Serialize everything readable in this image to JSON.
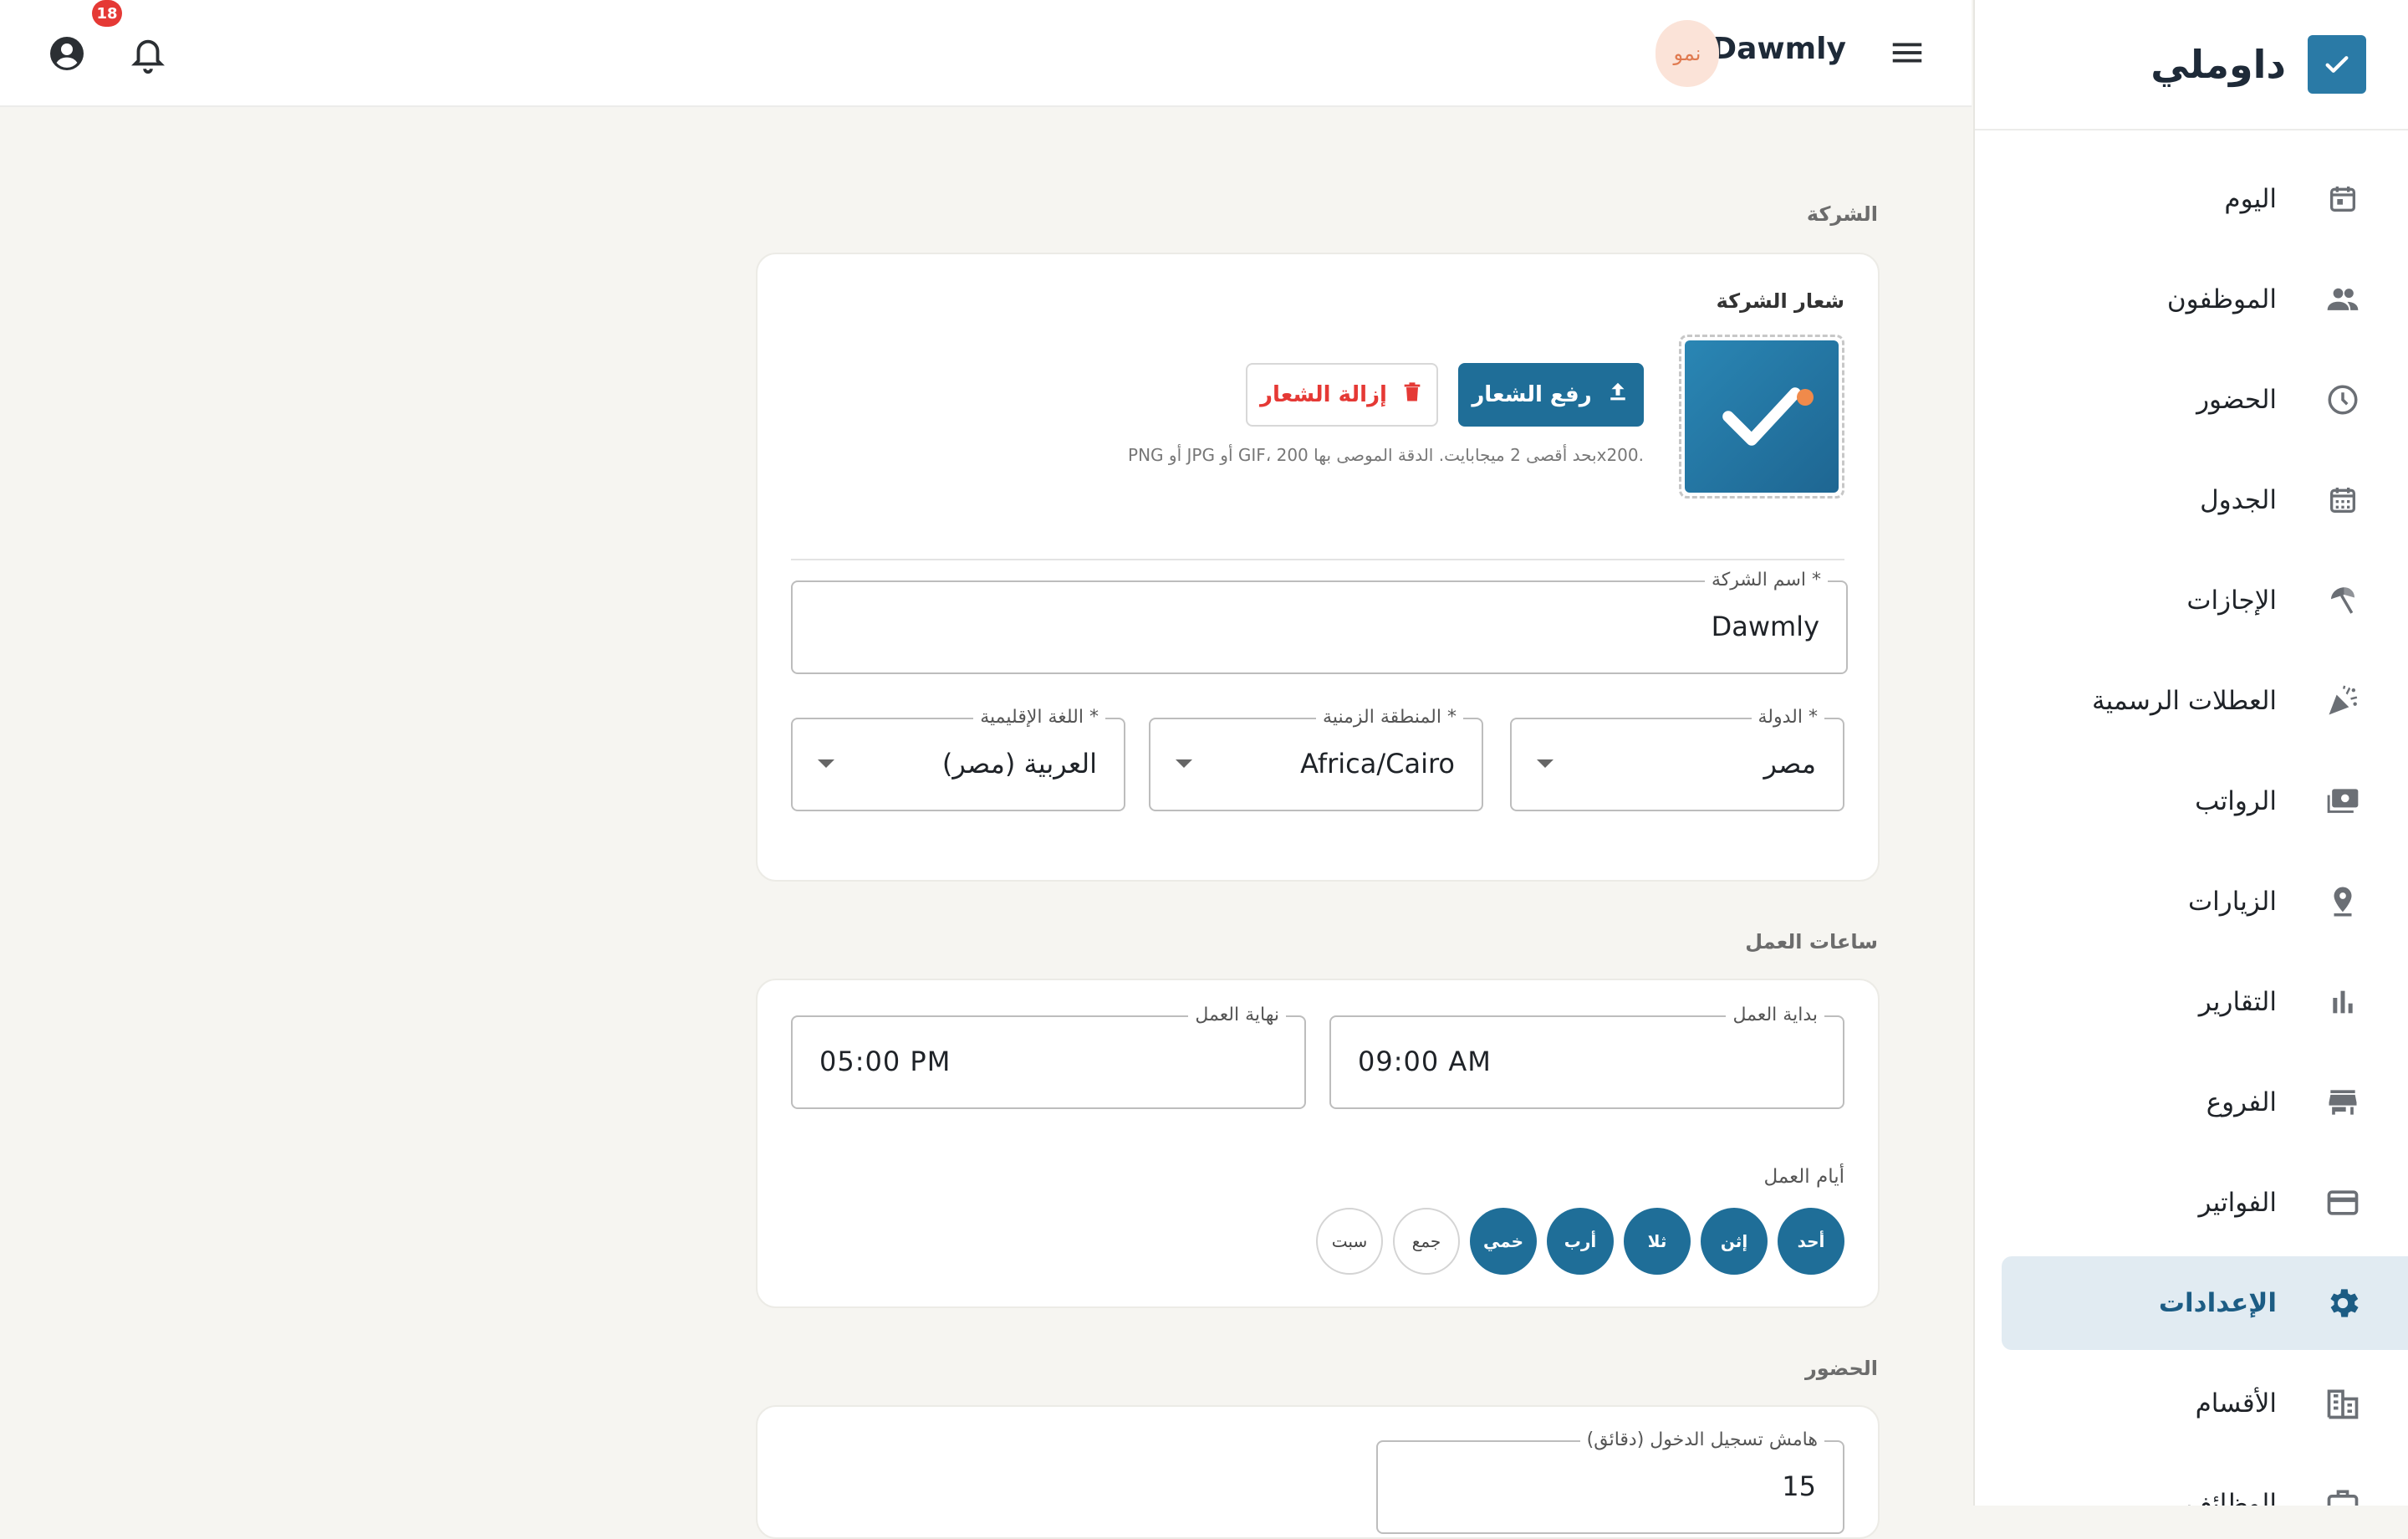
{
  "app": {
    "name": "داوملي",
    "company": "Dawmly",
    "avatar_text": "نمو",
    "notifications_count": "18"
  },
  "colors": {
    "accent": "#1f6e98",
    "brand": "#2a7aa6",
    "danger": "#e53935",
    "active_bg": "#e1ebf2"
  },
  "sidebar": {
    "items": [
      {
        "label": "اليوم",
        "icon": "calendar-today-icon"
      },
      {
        "label": "الموظفون",
        "icon": "people-icon"
      },
      {
        "label": "الحضور",
        "icon": "clock-icon"
      },
      {
        "label": "الجدول",
        "icon": "calendar-grid-icon"
      },
      {
        "label": "الإجازات",
        "icon": "beach-umbrella-icon"
      },
      {
        "label": "العطلات الرسمية",
        "icon": "celebration-icon"
      },
      {
        "label": "الرواتب",
        "icon": "payments-icon"
      },
      {
        "label": "الزيارات",
        "icon": "location-pin-icon"
      },
      {
        "label": "التقارير",
        "icon": "bar-chart-icon"
      },
      {
        "label": "الفروع",
        "icon": "store-icon"
      },
      {
        "label": "الفواتير",
        "icon": "credit-card-icon"
      },
      {
        "label": "الإعدادات",
        "icon": "gear-icon",
        "active": true
      },
      {
        "label": "الأقسام",
        "icon": "domain-icon"
      },
      {
        "label": "الوظائف",
        "icon": "briefcase-icon"
      }
    ]
  },
  "company_section": {
    "title": "الشركة",
    "logo_label": "شعار الشركة",
    "upload_label": "رفع الشعار",
    "remove_label": "إزالة الشعار",
    "logo_hint": "PNG أو JPG أو GIF، بحد أقصى 2 ميجابايت. الدقة الموصى بها 200x200.",
    "name_label": "اسم الشركة *",
    "name_value": "Dawmly",
    "country_label": "الدولة *",
    "country_value": "مصر",
    "timezone_label": "المنطقة الزمنية *",
    "timezone_value": "Africa/Cairo",
    "locale_label": "اللغة الإقليمية *",
    "locale_value": "العربية (مصر)"
  },
  "hours_section": {
    "title": "ساعات العمل",
    "start_label": "بداية العمل",
    "start_value": "09:00 AM",
    "end_label": "نهاية العمل",
    "end_value": "05:00 PM",
    "days_label": "أيام العمل",
    "days": [
      {
        "label": "أحد",
        "selected": true
      },
      {
        "label": "إثن",
        "selected": true
      },
      {
        "label": "ثلا",
        "selected": true
      },
      {
        "label": "أرب",
        "selected": true
      },
      {
        "label": "خمي",
        "selected": true
      },
      {
        "label": "جمع",
        "selected": false
      },
      {
        "label": "سبت",
        "selected": false
      }
    ]
  },
  "attendance_section": {
    "title": "الحضور",
    "grace_label": "هامش تسجيل الدخول (دقائق)",
    "grace_value": "15"
  }
}
